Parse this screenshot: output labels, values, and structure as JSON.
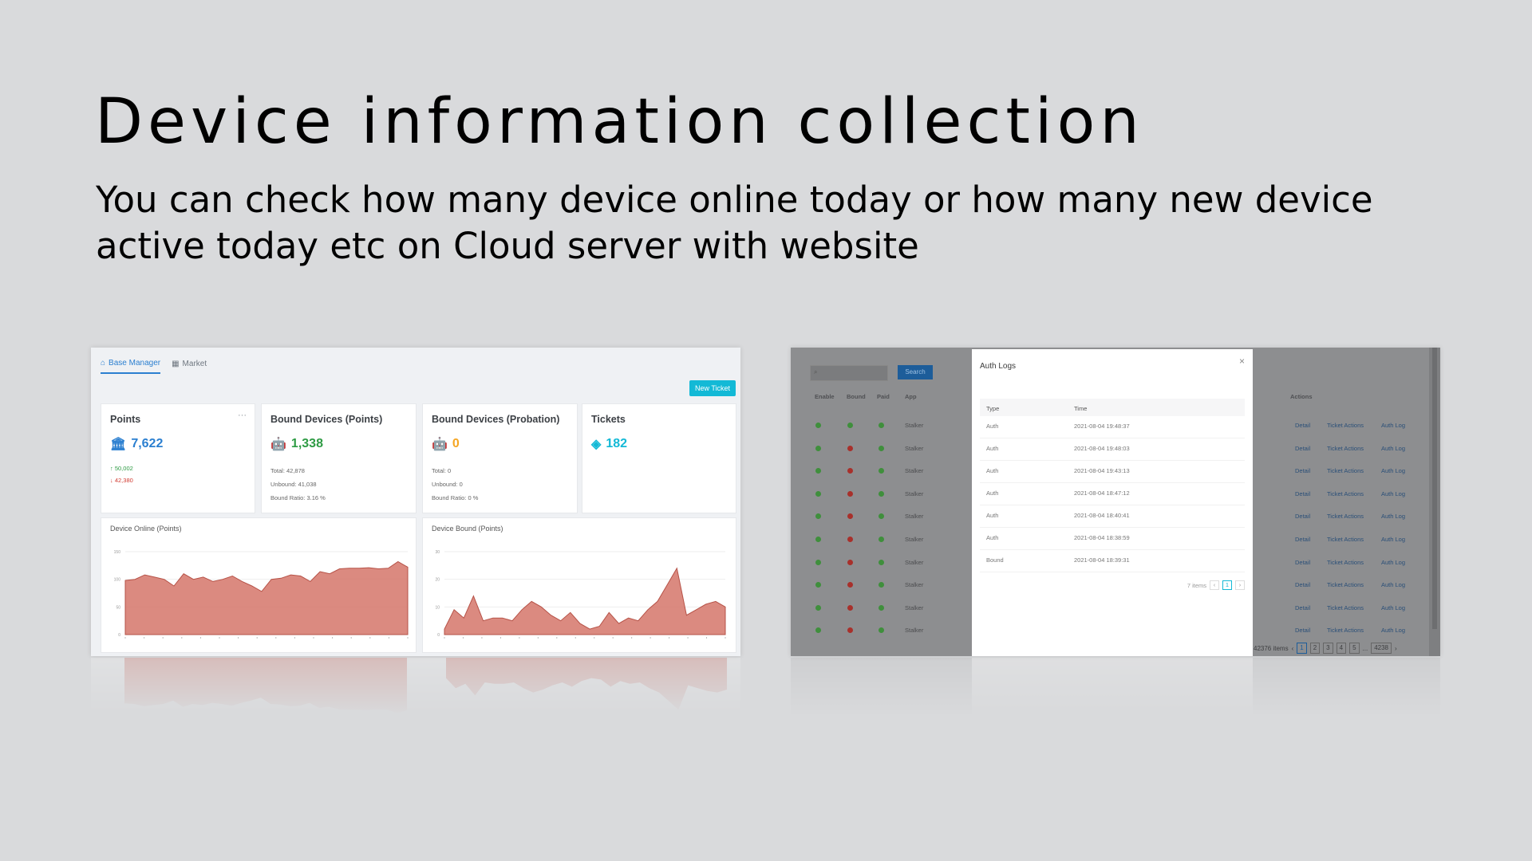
{
  "slide": {
    "title": "Device information collection",
    "subtitle": "You can check how many device online today or how many new device active today etc on Cloud server with website"
  },
  "dashboard": {
    "tabs": [
      {
        "label": "Base Manager",
        "icon": "home-icon",
        "active": true
      },
      {
        "label": "Market",
        "icon": "store-icon",
        "active": false
      }
    ],
    "new_ticket_label": "New Ticket",
    "cards": {
      "points": {
        "title": "Points",
        "value": "7,622",
        "up": "50,002",
        "down": "42,380",
        "icon": "bank-icon"
      },
      "bound_points": {
        "title": "Bound Devices (Points)",
        "value": "1,338",
        "total": "Total: 42,878",
        "unbound": "Unbound: 41,038",
        "ratio": "Bound Ratio: 3.16 %",
        "icon": "android-icon"
      },
      "bound_probation": {
        "title": "Bound Devices (Probation)",
        "value": "0",
        "total": "Total: 0",
        "unbound": "Unbound: 0",
        "ratio": "Bound Ratio: 0 %",
        "icon": "android-icon"
      },
      "tickets": {
        "title": "Tickets",
        "value": "182",
        "icon": "ticket-icon"
      }
    },
    "colors": {
      "accent": "#13b9d6",
      "blue": "#2b7fd0",
      "green": "#2e9b44",
      "orange": "#f5a623",
      "teal": "#13b9d6",
      "area": "#d5766a"
    }
  },
  "chart_data": [
    {
      "type": "area",
      "title": "Device Online (Points)",
      "ylim": [
        0,
        150
      ],
      "yticks": [
        "150",
        "100",
        "50",
        "0"
      ],
      "values": [
        98,
        100,
        108,
        104,
        100,
        88,
        110,
        100,
        104,
        96,
        100,
        106,
        96,
        88,
        78,
        100,
        102,
        108,
        106,
        96,
        114,
        110,
        119,
        120,
        120,
        121,
        119,
        120,
        132,
        122
      ]
    },
    {
      "type": "area",
      "title": "Device Bound (Points)",
      "ylim": [
        0,
        30
      ],
      "yticks": [
        "30",
        "20",
        "10",
        "0"
      ],
      "values": [
        2,
        9,
        6,
        14,
        5,
        6,
        6,
        5,
        9,
        12,
        10,
        7,
        5,
        8,
        4,
        2,
        3,
        8,
        4,
        6,
        5,
        9,
        12,
        18,
        24,
        7,
        9,
        11,
        12,
        10
      ]
    }
  ],
  "records": {
    "search_label": "Search",
    "columns": [
      "Enable",
      "Bound",
      "Paid",
      "App"
    ],
    "actions_header": "Actions",
    "app_value": "Stalker",
    "row_actions": [
      "Detail",
      "Ticket Actions",
      "Auth Log"
    ],
    "rows": [
      {
        "enable": "#3f8f3c",
        "bound": "#3f8f3c",
        "paid": "#3f8f3c"
      },
      {
        "enable": "#3f8f3c",
        "bound": "#a8302b",
        "paid": "#3f8f3c"
      },
      {
        "enable": "#3f8f3c",
        "bound": "#a8302b",
        "paid": "#3f8f3c"
      },
      {
        "enable": "#3f8f3c",
        "bound": "#a8302b",
        "paid": "#3f8f3c"
      },
      {
        "enable": "#3f8f3c",
        "bound": "#a8302b",
        "paid": "#3f8f3c"
      },
      {
        "enable": "#3f8f3c",
        "bound": "#a8302b",
        "paid": "#3f8f3c"
      },
      {
        "enable": "#3f8f3c",
        "bound": "#a8302b",
        "paid": "#3f8f3c"
      },
      {
        "enable": "#3f8f3c",
        "bound": "#a8302b",
        "paid": "#3f8f3c"
      },
      {
        "enable": "#3f8f3c",
        "bound": "#a8302b",
        "paid": "#3f8f3c"
      },
      {
        "enable": "#3f8f3c",
        "bound": "#a8302b",
        "paid": "#3f8f3c"
      }
    ],
    "total_items": "42376 items",
    "pages": [
      "1",
      "2",
      "3",
      "4",
      "5",
      "...",
      "4238"
    ]
  },
  "auth_logs": {
    "title": "Auth Logs",
    "headers": [
      "Type",
      "Time"
    ],
    "rows": [
      {
        "type": "Auth",
        "time": "2021-08-04 19:48:37"
      },
      {
        "type": "Auth",
        "time": "2021-08-04 19:48:03"
      },
      {
        "type": "Auth",
        "time": "2021-08-04 19:43:13"
      },
      {
        "type": "Auth",
        "time": "2021-08-04 18:47:12"
      },
      {
        "type": "Auth",
        "time": "2021-08-04 18:40:41"
      },
      {
        "type": "Auth",
        "time": "2021-08-04 18:38:59"
      },
      {
        "type": "Bound",
        "time": "2021-08-04 18:39:31"
      }
    ],
    "items_label": "7 items",
    "page": "1"
  }
}
